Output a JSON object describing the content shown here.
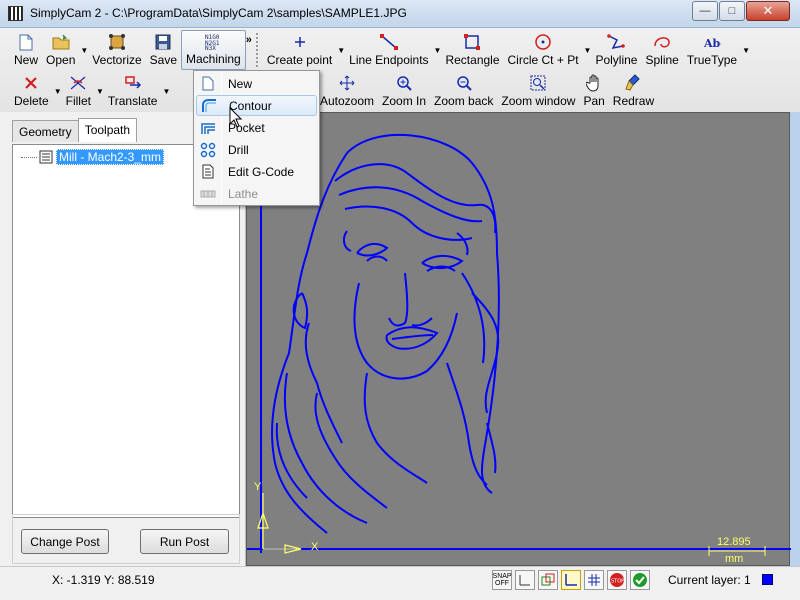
{
  "window": {
    "title": "SimplyCam 2 - C:\\ProgramData\\SimplyCam 2\\samples\\SAMPLE1.JPG",
    "minimize": "—",
    "maximize": "□",
    "close": "✕"
  },
  "toolbar1": {
    "new": "New",
    "open": "Open",
    "vectorize": "Vectorize",
    "save": "Save",
    "machining": "Machining",
    "overflow": "»",
    "create_point": "Create point",
    "line_endpoints": "Line Endpoints",
    "rectangle": "Rectangle",
    "circle": "Circle Ct + Pt",
    "polyline": "Polyline",
    "spline": "Spline",
    "truetype": "TrueType"
  },
  "toolbar2": {
    "delete": "Delete",
    "fillet": "Fillet",
    "translate": "Translate",
    "autozoom": "Autozoom",
    "zoom_in": "Zoom In",
    "zoom_back": "Zoom back",
    "zoom_window": "Zoom window",
    "pan": "Pan",
    "redraw": "Redraw"
  },
  "machining_menu": {
    "items": [
      {
        "label": "New",
        "icon": "new-doc-icon",
        "state": "normal"
      },
      {
        "label": "Contour",
        "icon": "contour-icon",
        "state": "highlighted"
      },
      {
        "label": "Pocket",
        "icon": "pocket-icon",
        "state": "normal"
      },
      {
        "label": "Drill",
        "icon": "drill-icon",
        "state": "normal"
      },
      {
        "label": "Edit G-Code",
        "icon": "gcode-icon",
        "state": "normal"
      },
      {
        "label": "Lathe",
        "icon": "lathe-icon",
        "state": "disabled"
      }
    ]
  },
  "left_panel": {
    "tabs": [
      "Geometry",
      "Toolpath"
    ],
    "selected_tab": "Toolpath",
    "tree_item": "Mill - Mach2-3_mm",
    "change_post": "Change Post",
    "run_post": "Run Post"
  },
  "canvas": {
    "axis_y": "Y",
    "axis_x": "X",
    "scale_value": "12.895",
    "scale_unit": "mm",
    "background": "#808080",
    "geometry_color": "#0000ff",
    "axis_color": "#ffff66"
  },
  "status": {
    "coords": "X: -1.319 Y: 88.519",
    "snap": "SNAP OFF",
    "layer": "Current layer: 1",
    "layer_color": "#0000ff"
  }
}
